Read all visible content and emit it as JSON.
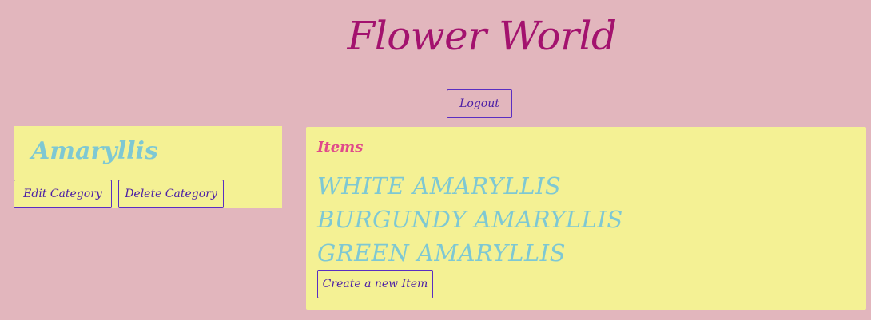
{
  "header": {
    "title": "Flower World",
    "logout_label": "Logout"
  },
  "category": {
    "name": "Amaryllis",
    "edit_label": "Edit Category",
    "delete_label": "Delete Category"
  },
  "items": {
    "heading": "Items",
    "list": [
      "WHITE AMARYLLIS",
      "BURGUNDY AMARYLLIS",
      "GREEN AMARYLLIS"
    ],
    "create_label": "Create a new Item"
  },
  "colors": {
    "background": "#e2b6bd",
    "panel": "#f4f194",
    "title": "#a3126e",
    "accent_text": "#7ec8d3",
    "heading": "#e04a8a",
    "button_border": "#5a2ec2"
  }
}
